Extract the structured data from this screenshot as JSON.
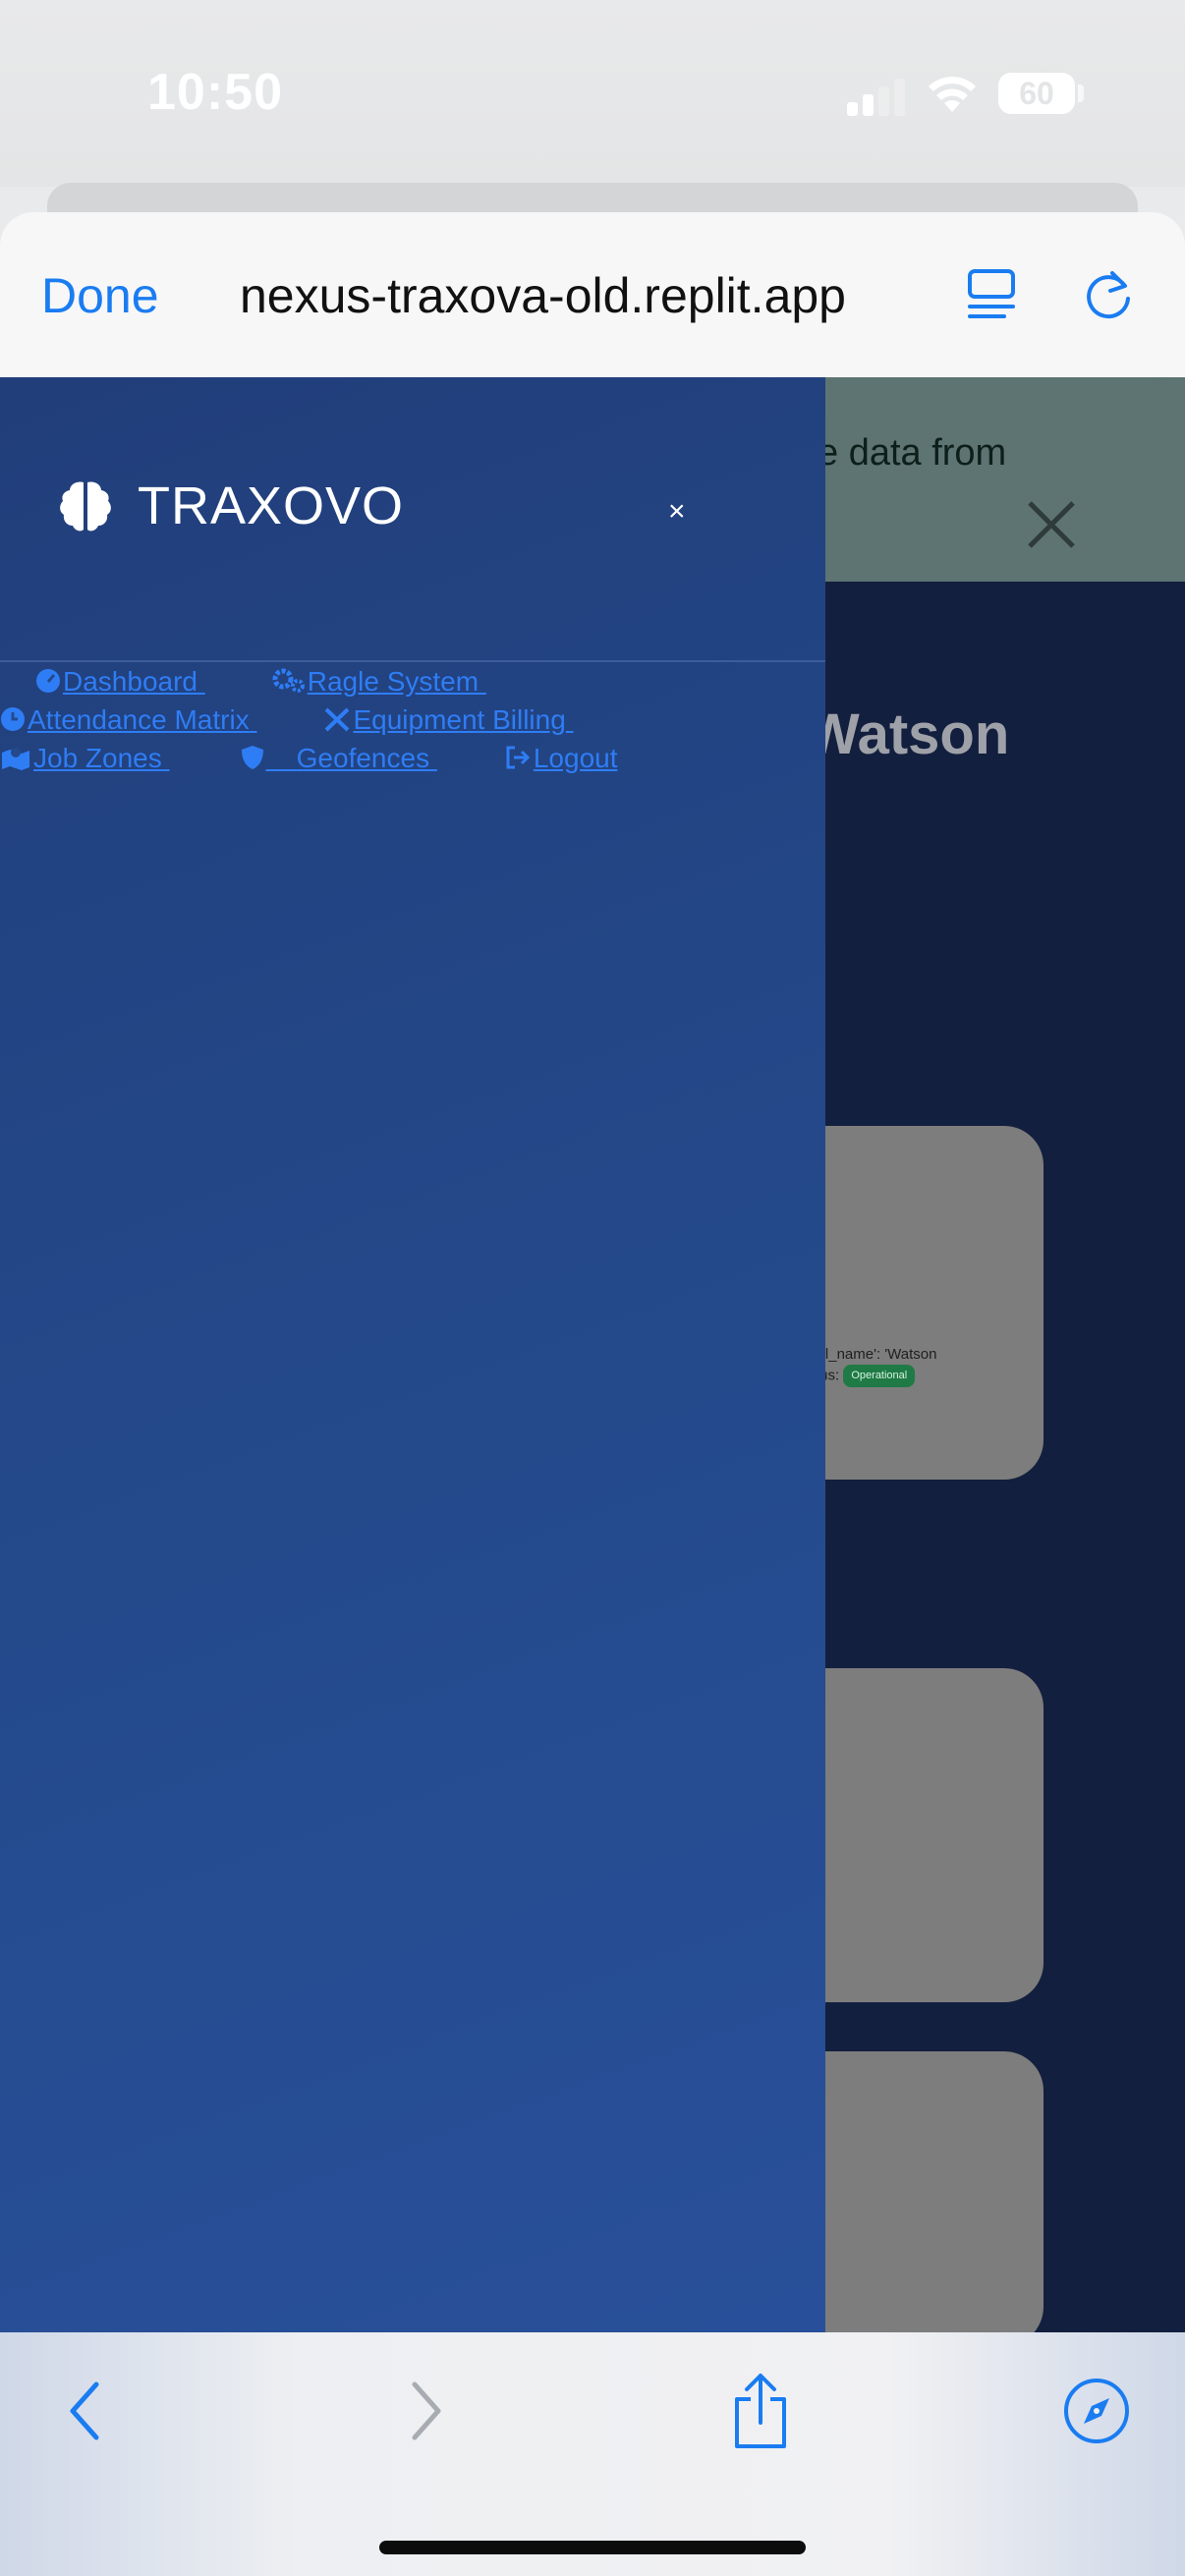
{
  "status_bar": {
    "time": "10:50",
    "battery_level": "60",
    "signal_bars_active": 2,
    "signal_bars_total": 4
  },
  "browser": {
    "done_label": "Done",
    "url": "nexus-traxova-old.replit.app",
    "accent_color": "#1a7cf1"
  },
  "sidebar": {
    "brand_name": "TRAXOVO",
    "close_symbol": "×",
    "nav_items": [
      {
        "label": "Dashboard",
        "icon": "dashboard-gauge-icon"
      },
      {
        "label": "Ragle System",
        "icon": "cogs-icon"
      },
      {
        "label": "Attendance Matrix",
        "icon": "clock-icon"
      },
      {
        "label": "Equipment Billing",
        "icon": "tools-icon"
      },
      {
        "label": "Job Zones",
        "icon": "map-marked-icon"
      },
      {
        "label": "Geofences",
        "icon": "shield-icon"
      },
      {
        "label": "Logout",
        "icon": "sign-out-icon"
      }
    ]
  },
  "page": {
    "alert_text": "e data from",
    "user_name": "Watson",
    "card_meta_line1": "', 'full_name': 'Watson",
    "card_meta_line2": "status:",
    "status_badge": "Operational"
  }
}
